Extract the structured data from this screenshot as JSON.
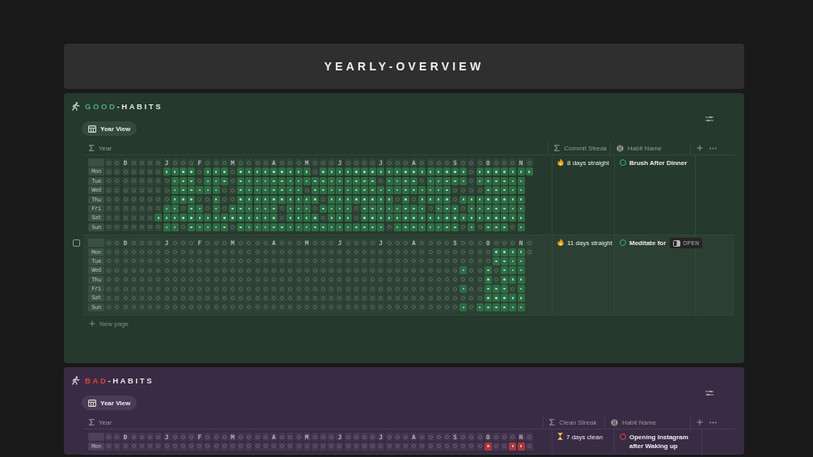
{
  "title": "YEARLY-OVERVIEW",
  "sections": [
    {
      "kind": "good",
      "accent": "GOOD",
      "rest": "-HABITS",
      "view": "Year View",
      "columns": [
        "Year",
        "Commit Streak",
        "Habit Name"
      ],
      "new_page": "New page",
      "rows": [
        {
          "hovered": false,
          "streak": "8 days straight",
          "name": "Brush After Dinner",
          "header": [
            {
              "kind": "blank"
            },
            {
              "kind": "blank"
            },
            {
              "kind": "month",
              "label": "D"
            },
            {
              "kind": "blank"
            },
            {
              "kind": "blank"
            },
            {
              "kind": "blank"
            },
            {
              "kind": "blank"
            },
            {
              "kind": "month",
              "label": "J"
            },
            {
              "kind": "blank"
            },
            {
              "kind": "blank"
            },
            {
              "kind": "blank"
            },
            {
              "kind": "month",
              "label": "F"
            },
            {
              "kind": "blank"
            },
            {
              "kind": "blank"
            },
            {
              "kind": "blank"
            },
            {
              "kind": "month",
              "label": "M"
            },
            {
              "kind": "blank"
            },
            {
              "kind": "blank"
            },
            {
              "kind": "blank"
            },
            {
              "kind": "blank"
            },
            {
              "kind": "month",
              "label": "A"
            },
            {
              "kind": "blank"
            },
            {
              "kind": "blank"
            },
            {
              "kind": "blank"
            },
            {
              "kind": "month",
              "label": "M"
            },
            {
              "kind": "blank"
            },
            {
              "kind": "blank"
            },
            {
              "kind": "blank"
            },
            {
              "kind": "month",
              "label": "J"
            },
            {
              "kind": "blank"
            },
            {
              "kind": "blank"
            },
            {
              "kind": "blank"
            },
            {
              "kind": "blank"
            },
            {
              "kind": "month",
              "label": "J"
            },
            {
              "kind": "blank"
            },
            {
              "kind": "blank"
            },
            {
              "kind": "blank"
            },
            {
              "kind": "month",
              "label": "A"
            },
            {
              "kind": "blank"
            },
            {
              "kind": "blank"
            },
            {
              "kind": "blank"
            },
            {
              "kind": "blank"
            },
            {
              "kind": "month",
              "label": "S"
            },
            {
              "kind": "blank"
            },
            {
              "kind": "blank"
            },
            {
              "kind": "blank"
            },
            {
              "kind": "month",
              "label": "O"
            },
            {
              "kind": "blank"
            },
            {
              "kind": "blank"
            },
            {
              "kind": "blank"
            },
            {
              "kind": "month",
              "label": "N"
            },
            {
              "kind": "blank"
            }
          ],
          "days": [
            {
              "day": "Mon",
              "done": [
                false,
                false,
                false,
                false,
                false,
                false,
                false,
                true,
                true,
                true,
                true,
                false,
                true,
                true,
                true,
                false,
                true,
                true,
                true,
                true,
                true,
                true,
                true,
                true,
                true,
                false,
                true,
                true,
                true,
                true,
                true,
                true,
                true,
                true,
                true,
                true,
                true,
                true,
                true,
                true,
                true,
                true,
                true,
                true,
                false,
                true,
                true,
                true,
                true,
                true,
                true,
                true
              ]
            },
            {
              "day": "Tue",
              "done": [
                false,
                false,
                false,
                false,
                false,
                false,
                false,
                false,
                true,
                true,
                true,
                false,
                true,
                true,
                true,
                false,
                true,
                true,
                true,
                true,
                true,
                true,
                true,
                true,
                true,
                true,
                true,
                true,
                true,
                true,
                true,
                true,
                true,
                false,
                true,
                true,
                true,
                true,
                false,
                true,
                true,
                true,
                true,
                true,
                false,
                true,
                true,
                true,
                true,
                true,
                true
              ]
            },
            {
              "day": "Wed",
              "done": [
                false,
                false,
                false,
                false,
                false,
                false,
                false,
                false,
                true,
                true,
                true,
                true,
                true,
                true,
                false,
                false,
                true,
                true,
                true,
                true,
                true,
                true,
                true,
                true,
                false,
                true,
                true,
                true,
                true,
                true,
                true,
                true,
                true,
                true,
                true,
                true,
                true,
                true,
                true,
                true,
                true,
                true,
                false,
                false,
                false,
                false,
                true,
                true,
                true,
                true,
                true
              ]
            },
            {
              "day": "Thu",
              "done": [
                false,
                false,
                false,
                false,
                false,
                false,
                false,
                false,
                true,
                true,
                true,
                false,
                false,
                true,
                false,
                false,
                true,
                true,
                true,
                true,
                true,
                true,
                true,
                true,
                true,
                true,
                false,
                true,
                true,
                true,
                true,
                true,
                true,
                true,
                true,
                false,
                true,
                false,
                true,
                true,
                true,
                true,
                false,
                true,
                true,
                true,
                true,
                true,
                true,
                true,
                true
              ]
            },
            {
              "day": "Fri",
              "done": [
                false,
                false,
                false,
                false,
                false,
                false,
                false,
                true,
                true,
                false,
                true,
                true,
                false,
                true,
                false,
                true,
                true,
                true,
                true,
                true,
                true,
                false,
                true,
                true,
                true,
                false,
                true,
                true,
                true,
                true,
                false,
                true,
                true,
                true,
                true,
                true,
                true,
                true,
                true,
                false,
                true,
                true,
                true,
                false,
                true,
                true,
                true,
                true,
                true,
                true,
                true
              ]
            },
            {
              "day": "Sat",
              "done": [
                false,
                false,
                false,
                false,
                false,
                false,
                true,
                true,
                true,
                true,
                true,
                true,
                true,
                true,
                true,
                true,
                true,
                true,
                true,
                true,
                true,
                false,
                true,
                true,
                true,
                true,
                false,
                true,
                true,
                true,
                false,
                true,
                true,
                true,
                true,
                true,
                true,
                true,
                true,
                true,
                true,
                true,
                true,
                true,
                true,
                true,
                true,
                true,
                true,
                true,
                true
              ]
            },
            {
              "day": "Sun",
              "done": [
                false,
                false,
                false,
                false,
                false,
                false,
                false,
                true,
                true,
                false,
                true,
                true,
                true,
                true,
                true,
                false,
                true,
                true,
                true,
                true,
                true,
                true,
                true,
                true,
                true,
                true,
                true,
                true,
                true,
                true,
                true,
                true,
                true,
                true,
                false,
                true,
                true,
                true,
                true,
                true,
                true,
                true,
                true,
                false,
                true,
                false,
                true,
                true,
                true,
                false,
                true
              ]
            }
          ]
        },
        {
          "hovered": true,
          "open_label": "OPEN",
          "streak": "11 days straight",
          "name": "Meditate for",
          "header": [
            {
              "kind": "blank"
            },
            {
              "kind": "blank"
            },
            {
              "kind": "month",
              "label": "D"
            },
            {
              "kind": "blank"
            },
            {
              "kind": "blank"
            },
            {
              "kind": "blank"
            },
            {
              "kind": "blank"
            },
            {
              "kind": "month",
              "label": "J"
            },
            {
              "kind": "blank"
            },
            {
              "kind": "blank"
            },
            {
              "kind": "blank"
            },
            {
              "kind": "month",
              "label": "F"
            },
            {
              "kind": "blank"
            },
            {
              "kind": "blank"
            },
            {
              "kind": "blank"
            },
            {
              "kind": "month",
              "label": "M"
            },
            {
              "kind": "blank"
            },
            {
              "kind": "blank"
            },
            {
              "kind": "blank"
            },
            {
              "kind": "blank"
            },
            {
              "kind": "month",
              "label": "A"
            },
            {
              "kind": "blank"
            },
            {
              "kind": "blank"
            },
            {
              "kind": "blank"
            },
            {
              "kind": "month",
              "label": "M"
            },
            {
              "kind": "blank"
            },
            {
              "kind": "blank"
            },
            {
              "kind": "blank"
            },
            {
              "kind": "month",
              "label": "J"
            },
            {
              "kind": "blank"
            },
            {
              "kind": "blank"
            },
            {
              "kind": "blank"
            },
            {
              "kind": "blank"
            },
            {
              "kind": "month",
              "label": "J"
            },
            {
              "kind": "blank"
            },
            {
              "kind": "blank"
            },
            {
              "kind": "blank"
            },
            {
              "kind": "month",
              "label": "A"
            },
            {
              "kind": "blank"
            },
            {
              "kind": "blank"
            },
            {
              "kind": "blank"
            },
            {
              "kind": "blank"
            },
            {
              "kind": "month",
              "label": "S"
            },
            {
              "kind": "blank"
            },
            {
              "kind": "blank"
            },
            {
              "kind": "blank"
            },
            {
              "kind": "month",
              "label": "O"
            },
            {
              "kind": "blank"
            },
            {
              "kind": "blank"
            },
            {
              "kind": "blank"
            },
            {
              "kind": "month",
              "label": "N"
            },
            {
              "kind": "blank"
            }
          ],
          "days": [
            {
              "day": "Mon",
              "done": [
                false,
                false,
                false,
                false,
                false,
                false,
                false,
                false,
                false,
                false,
                false,
                false,
                false,
                false,
                false,
                false,
                false,
                false,
                false,
                false,
                false,
                false,
                false,
                false,
                false,
                false,
                false,
                false,
                false,
                false,
                false,
                false,
                false,
                false,
                false,
                false,
                false,
                false,
                false,
                false,
                false,
                false,
                false,
                false,
                false,
                false,
                false,
                true,
                true,
                true,
                true,
                false
              ]
            },
            {
              "day": "Tue",
              "done": [
                false,
                false,
                false,
                false,
                false,
                false,
                false,
                false,
                false,
                false,
                false,
                false,
                false,
                false,
                false,
                false,
                false,
                false,
                false,
                false,
                false,
                false,
                false,
                false,
                false,
                false,
                false,
                false,
                false,
                false,
                false,
                false,
                false,
                false,
                false,
                false,
                false,
                false,
                false,
                false,
                false,
                false,
                false,
                false,
                false,
                false,
                false,
                true,
                true,
                true,
                true
              ]
            },
            {
              "day": "Wed",
              "done": [
                false,
                false,
                false,
                false,
                false,
                false,
                false,
                false,
                false,
                false,
                false,
                false,
                false,
                false,
                false,
                false,
                false,
                false,
                false,
                false,
                false,
                false,
                false,
                false,
                false,
                false,
                false,
                false,
                false,
                false,
                false,
                false,
                false,
                false,
                false,
                false,
                false,
                false,
                false,
                false,
                false,
                false,
                false,
                true,
                false,
                false,
                true,
                false,
                true,
                true,
                true
              ]
            },
            {
              "day": "Thu",
              "done": [
                false,
                false,
                false,
                false,
                false,
                false,
                false,
                false,
                false,
                false,
                false,
                false,
                false,
                false,
                false,
                false,
                false,
                false,
                false,
                false,
                false,
                false,
                false,
                false,
                false,
                false,
                false,
                false,
                false,
                false,
                false,
                false,
                false,
                false,
                false,
                false,
                false,
                false,
                false,
                false,
                false,
                false,
                false,
                false,
                false,
                false,
                true,
                false,
                true,
                true,
                true
              ]
            },
            {
              "day": "Fri",
              "done": [
                false,
                false,
                false,
                false,
                false,
                false,
                false,
                false,
                false,
                false,
                false,
                false,
                false,
                false,
                false,
                false,
                false,
                false,
                false,
                false,
                false,
                false,
                false,
                false,
                false,
                false,
                false,
                false,
                false,
                false,
                false,
                false,
                false,
                false,
                false,
                false,
                false,
                false,
                false,
                false,
                false,
                false,
                false,
                true,
                false,
                false,
                true,
                true,
                true,
                false,
                true
              ]
            },
            {
              "day": "Sat",
              "done": [
                false,
                false,
                false,
                false,
                false,
                false,
                false,
                false,
                false,
                false,
                false,
                false,
                false,
                false,
                false,
                false,
                false,
                false,
                false,
                false,
                false,
                false,
                false,
                false,
                false,
                false,
                false,
                false,
                false,
                false,
                false,
                false,
                false,
                false,
                false,
                false,
                false,
                false,
                false,
                false,
                false,
                false,
                false,
                false,
                false,
                false,
                true,
                true,
                true,
                true,
                true
              ]
            },
            {
              "day": "Sun",
              "done": [
                false,
                false,
                false,
                false,
                false,
                false,
                false,
                false,
                false,
                false,
                false,
                false,
                false,
                false,
                false,
                false,
                false,
                false,
                false,
                false,
                false,
                false,
                false,
                false,
                false,
                false,
                false,
                false,
                false,
                false,
                false,
                false,
                false,
                false,
                false,
                false,
                false,
                false,
                false,
                false,
                false,
                false,
                false,
                true,
                false,
                true,
                true,
                true,
                true,
                true,
                true
              ]
            }
          ]
        }
      ]
    },
    {
      "kind": "bad",
      "accent": "BAD",
      "rest": "-HABITS",
      "view": "Year View",
      "columns": [
        "Year",
        "Clean Streak",
        "Habit Name"
      ],
      "rows": [
        {
          "streak": "7 days clean",
          "name": "Opening Instagram after Waking up",
          "header": [
            {
              "kind": "blank"
            },
            {
              "kind": "blank"
            },
            {
              "kind": "month",
              "label": "D"
            },
            {
              "kind": "blank"
            },
            {
              "kind": "blank"
            },
            {
              "kind": "blank"
            },
            {
              "kind": "blank"
            },
            {
              "kind": "month",
              "label": "J"
            },
            {
              "kind": "blank"
            },
            {
              "kind": "blank"
            },
            {
              "kind": "blank"
            },
            {
              "kind": "month",
              "label": "F"
            },
            {
              "kind": "blank"
            },
            {
              "kind": "blank"
            },
            {
              "kind": "blank"
            },
            {
              "kind": "month",
              "label": "M"
            },
            {
              "kind": "blank"
            },
            {
              "kind": "blank"
            },
            {
              "kind": "blank"
            },
            {
              "kind": "blank"
            },
            {
              "kind": "month",
              "label": "A"
            },
            {
              "kind": "blank"
            },
            {
              "kind": "blank"
            },
            {
              "kind": "blank"
            },
            {
              "kind": "month",
              "label": "M"
            },
            {
              "kind": "blank"
            },
            {
              "kind": "blank"
            },
            {
              "kind": "blank"
            },
            {
              "kind": "month",
              "label": "J"
            },
            {
              "kind": "blank"
            },
            {
              "kind": "blank"
            },
            {
              "kind": "blank"
            },
            {
              "kind": "blank"
            },
            {
              "kind": "month",
              "label": "J"
            },
            {
              "kind": "blank"
            },
            {
              "kind": "blank"
            },
            {
              "kind": "blank"
            },
            {
              "kind": "month",
              "label": "A"
            },
            {
              "kind": "blank"
            },
            {
              "kind": "blank"
            },
            {
              "kind": "blank"
            },
            {
              "kind": "blank"
            },
            {
              "kind": "month",
              "label": "S"
            },
            {
              "kind": "blank"
            },
            {
              "kind": "blank"
            },
            {
              "kind": "blank"
            },
            {
              "kind": "month",
              "label": "O"
            },
            {
              "kind": "blank"
            },
            {
              "kind": "blank"
            },
            {
              "kind": "blank"
            },
            {
              "kind": "month",
              "label": "N"
            },
            {
              "kind": "blank"
            }
          ],
          "days": [
            {
              "day": "Mon",
              "done": [
                false,
                false,
                false,
                false,
                false,
                false,
                false,
                false,
                false,
                false,
                false,
                false,
                false,
                false,
                false,
                false,
                false,
                false,
                false,
                false,
                false,
                false,
                false,
                false,
                false,
                false,
                false,
                false,
                false,
                false,
                false,
                false,
                false,
                false,
                false,
                false,
                false,
                false,
                false,
                false,
                false,
                false,
                false,
                false,
                false,
                false,
                true,
                false,
                false,
                true,
                true,
                false
              ]
            }
          ]
        }
      ]
    }
  ]
}
